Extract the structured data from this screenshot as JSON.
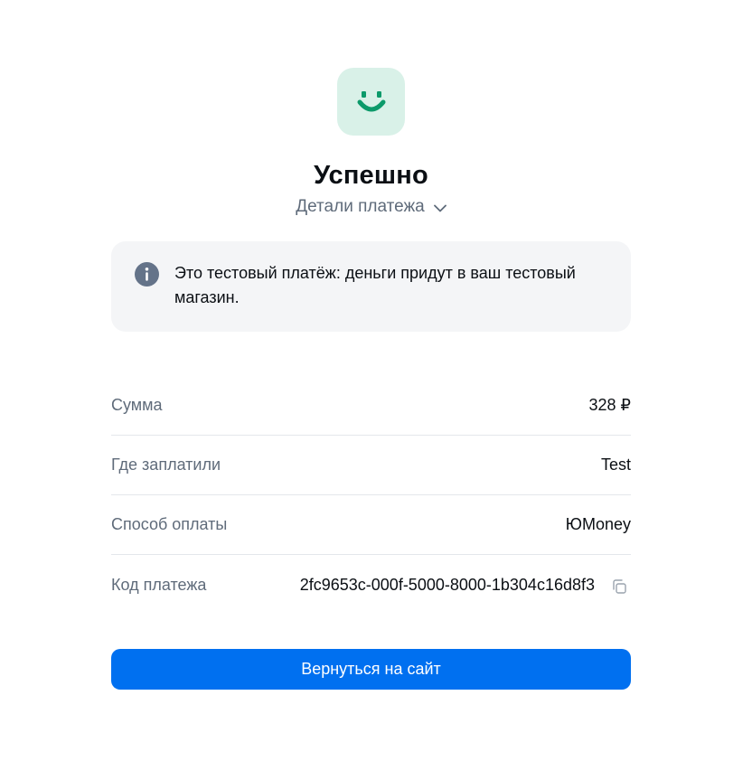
{
  "header": {
    "logo_icon": "smile-logo-icon",
    "title": "Успешно",
    "details_label": "Детали платежа",
    "details_icon": "chevron-down-icon"
  },
  "notice": {
    "icon": "info-icon",
    "text": "Это тестовый платёж: деньги придут в ваш тестовый магазин."
  },
  "details": {
    "amount_label": "Сумма",
    "amount_value": "328 ₽",
    "merchant_label": "Где заплатили",
    "merchant_value": "Test",
    "method_label": "Способ оплаты",
    "method_value": "ЮMoney",
    "payment_id_label": "Код платежа",
    "payment_id_value": "2fc9653c-000f-5000-8000-1b304c16d8f3",
    "copy_icon": "copy-icon"
  },
  "actions": {
    "return_label": "Вернуться на сайт"
  },
  "colors": {
    "accent": "#0070f0",
    "logo_bg": "#d9f1e8",
    "logo_fg": "#0c9a6a",
    "notice_bg": "#f4f5f7",
    "info_icon": "#647389"
  }
}
